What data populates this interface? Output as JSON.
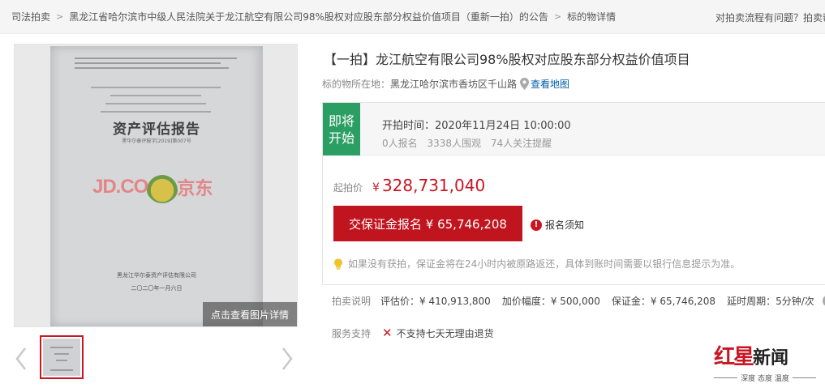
{
  "breadcrumb": {
    "items": [
      "司法拍卖",
      "黑龙江省哈尔滨市中级人民法院关于龙江航空有限公司98%股权对应股东部分权益价值项目（重新一拍）的公告",
      "标的物详情"
    ],
    "help": "对拍卖流程有问题？拍卖帮"
  },
  "gallery": {
    "document_title": "资产评估报告",
    "document_number": "黑华尔泰评报字[2019]第007号",
    "document_org": "黑龙江华尔泰资产评估有限公司",
    "document_date": "二〇二〇年一月六日",
    "watermark_left": "JD.CO",
    "watermark_right": "京东",
    "view_detail_label": "点击查看图片详情"
  },
  "item": {
    "title": "【一拍】龙江航空有限公司98%股权对应股东部分权益价值项目",
    "location_label": "标的物所在地：",
    "location_value": "黑龙江哈尔滨市香坊区千山路",
    "map_link": "查看地图"
  },
  "auction": {
    "status_badge": "即将开始",
    "start_time": "开拍时间：2020年11月24日 10:00:00",
    "registered": "0人报名",
    "watchers": "3338人围观",
    "reminders": "74人关注提醒",
    "start_price_label": "起拍价",
    "currency": "¥",
    "start_price": "328,731,040",
    "deposit_button": "交保证金报名 ¥ 65,746,208",
    "notice_link": "报名须知",
    "tip": "如果没有获拍，保证金将在24小时内被原路返还，具体到账时间需要以银行信息提示为准。"
  },
  "auction_info": {
    "label": "拍卖说明",
    "appraisal": "评估价：¥ 410,913,800",
    "increment": "加价幅度：¥ 500,000",
    "deposit": "保证金：¥ 65,746,208",
    "delay": "延时周期：5分钟/次"
  },
  "service": {
    "label": "服务支持",
    "value": "不支持七天无理由退货"
  },
  "brand": {
    "logo_red": "红星",
    "logo_black": "新闻",
    "tagline": "深度 态度 温度"
  },
  "colors": {
    "accent_red": "#c81623",
    "badge_green": "#2b9f63",
    "link_blue": "#005ea7"
  }
}
